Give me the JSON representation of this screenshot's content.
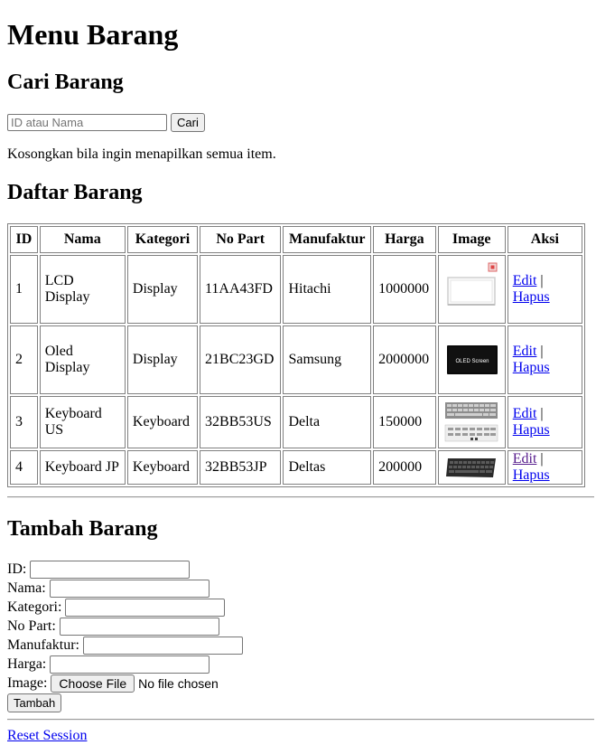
{
  "page": {
    "title": "Menu Barang"
  },
  "search": {
    "heading": "Cari Barang",
    "placeholder": "ID atau Nama",
    "button_label": "Cari",
    "hint": "Kosongkan bila ingin menapilkan semua item."
  },
  "list": {
    "heading": "Daftar Barang",
    "columns": [
      "ID",
      "Nama",
      "Kategori",
      "No Part",
      "Manufaktur",
      "Harga",
      "Image",
      "Aksi"
    ],
    "rows": [
      {
        "id": "1",
        "nama": "LCD Display",
        "kategori": "Display",
        "no_part": "11AA43FD",
        "manufaktur": "Hitachi",
        "harga": "1000000",
        "image_icon": "lcd-panel-icon",
        "edit": "Edit",
        "sep": "|",
        "hapus": "Hapus"
      },
      {
        "id": "2",
        "nama": "Oled Display",
        "kategori": "Display",
        "no_part": "21BC23GD",
        "manufaktur": "Samsung",
        "harga": "2000000",
        "image_icon": "oled-screen-icon",
        "image_text": "OLED Screen",
        "edit": "Edit",
        "sep": "|",
        "hapus": "Hapus"
      },
      {
        "id": "3",
        "nama": "Keyboard US",
        "kategori": "Keyboard",
        "no_part": "32BB53US",
        "manufaktur": "Delta",
        "harga": "150000",
        "image_icon": "keyboard-grey-icon",
        "edit": "Edit",
        "sep": "|",
        "hapus": "Hapus"
      },
      {
        "id": "4",
        "nama": "Keyboard JP",
        "kategori": "Keyboard",
        "no_part": "32BB53JP",
        "manufaktur": "Deltas",
        "harga": "200000",
        "image_icon": "keyboard-black-icon",
        "edit": "Edit",
        "sep": "|",
        "hapus": "Hapus"
      }
    ]
  },
  "form": {
    "heading": "Tambah Barang",
    "fields": {
      "id": "ID:",
      "nama": "Nama:",
      "kategori": "Kategori:",
      "no_part": "No Part:",
      "manufaktur": "Manufaktur:",
      "harga": "Harga:",
      "image": "Image:"
    },
    "file_button": "Choose File",
    "file_status": "No file chosen",
    "submit_label": "Tambah"
  },
  "footer": {
    "reset_link": "Reset Session"
  },
  "colors": {
    "link": "#0000ee",
    "visited_link": "#551a8b"
  }
}
